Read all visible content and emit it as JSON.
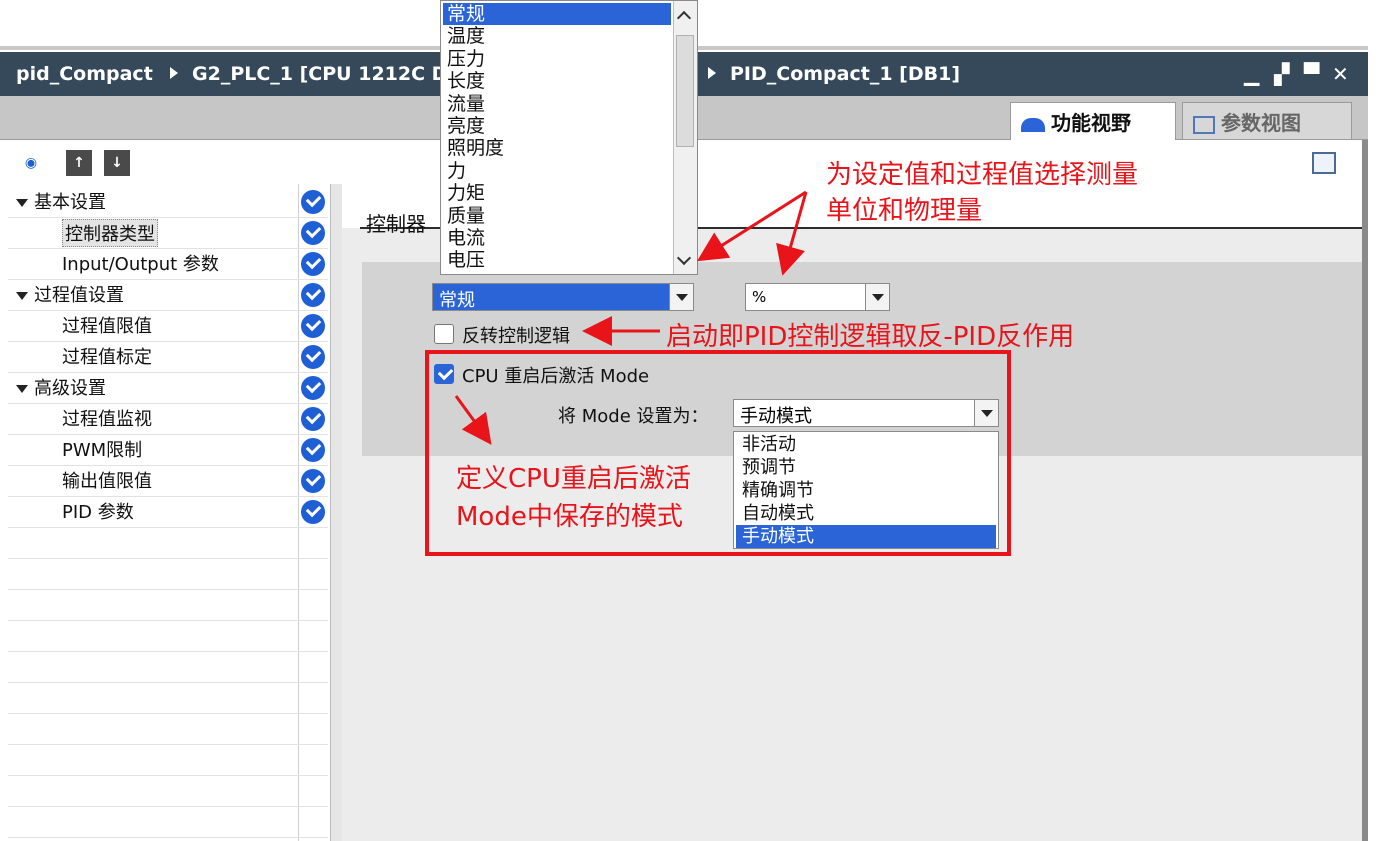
{
  "window": {
    "breadcrumb_root": "pid_Compact",
    "breadcrumb_plc": "G2_PLC_1 [CPU 1212C D",
    "breadcrumb_db": "PID_Compact_1 [DB1]",
    "min_label": "▁",
    "restore_label": "▞",
    "max_label": "▀",
    "close_label": "✕"
  },
  "tabs": {
    "function_view": "功能视野",
    "param_view": "参数视图"
  },
  "sidebar": {
    "items": [
      {
        "label": "基本设置",
        "group": true
      },
      {
        "label": "控制器类型",
        "group": false
      },
      {
        "label": "Input/Output 参数",
        "group": false
      },
      {
        "label": "过程值设置",
        "group": true
      },
      {
        "label": "过程值限值",
        "group": false
      },
      {
        "label": "过程值标定",
        "group": false
      },
      {
        "label": "高级设置",
        "group": true
      },
      {
        "label": "过程值监视",
        "group": false
      },
      {
        "label": "PWM限制",
        "group": false
      },
      {
        "label": "输出值限值",
        "group": false
      },
      {
        "label": "PID 参数",
        "group": false
      }
    ]
  },
  "main": {
    "section_title": "控制器",
    "type_value": "常规",
    "unit_value": "%",
    "invert_label": "反转控制逻辑",
    "cpu_restart_label": "CPU 重启后激活 Mode",
    "set_mode_label": "将 Mode 设置为：",
    "mode_value": "手动模式"
  },
  "type_list": {
    "items": [
      "常规",
      "温度",
      "压力",
      "长度",
      "流量",
      "亮度",
      "照明度",
      "力",
      "力矩",
      "质量",
      "电流",
      "电压"
    ],
    "selected": "常规"
  },
  "mode_list": {
    "items": [
      "非活动",
      "预调节",
      "精确调节",
      "自动模式",
      "手动模式"
    ],
    "selected": "手动模式"
  },
  "annotations": {
    "unit_note_line1": "为设定值和过程值选择测量",
    "unit_note_line2": "单位和物理量",
    "invert_note": "启动即PID控制逻辑取反-PID反作用",
    "mode_note_line1": "定义CPU重启后激活",
    "mode_note_line2": "Mode中保存的模式"
  },
  "colors": {
    "title_bar": "#36495a",
    "accent_blue": "#2a64d6",
    "annotation_red": "#e8141a"
  }
}
